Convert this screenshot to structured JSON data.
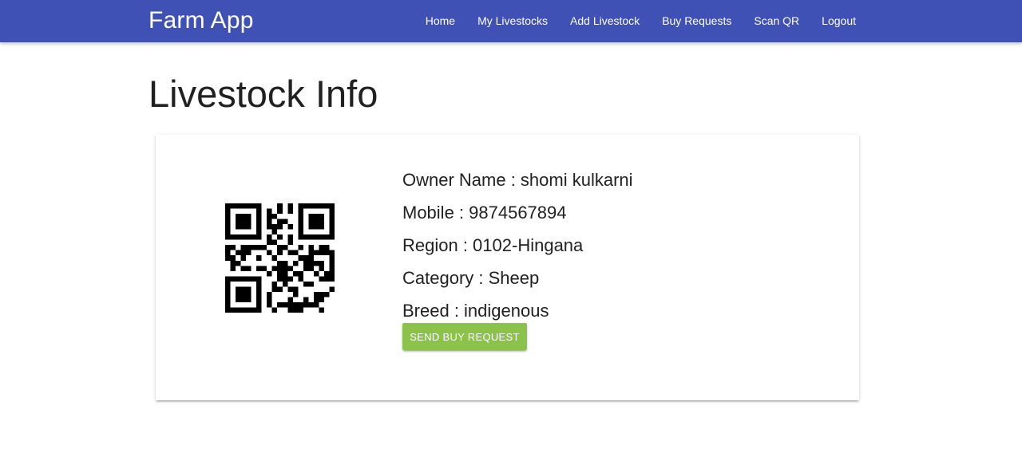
{
  "navbar": {
    "brand": "Farm App",
    "background": "#3f51b5",
    "links": [
      {
        "label": "Home"
      },
      {
        "label": "My Livestocks"
      },
      {
        "label": "Add Livestock"
      },
      {
        "label": "Buy Requests"
      },
      {
        "label": "Scan QR"
      },
      {
        "label": "Logout"
      }
    ]
  },
  "page": {
    "title": "Livestock Info"
  },
  "livestock": {
    "owner_name": "Owner Name : shomi kulkarni",
    "mobile": "Mobile : 9874567894",
    "region": "Region : 0102-Hingana",
    "category": "Category : Sheep",
    "breed": "Breed : indigenous",
    "qr_icon": "qr-code"
  },
  "actions": {
    "send_buy_request": "SEND BUY REQUEST",
    "button_color": "#8bc34a"
  }
}
